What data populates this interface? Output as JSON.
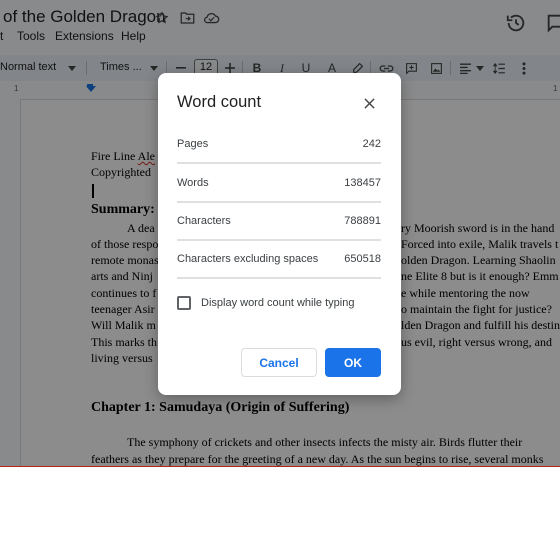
{
  "document": {
    "title": "of the Golden Dragon",
    "menu": [
      "t",
      "Tools",
      "Extensions",
      "Help"
    ]
  },
  "toolbar": {
    "style": "Normal text",
    "font": "Times ...",
    "font_size": "12"
  },
  "ruler": {
    "left_number": "1",
    "right_number": "1"
  },
  "body": {
    "line1_prefix": "Fire Line ",
    "line1_misspelled": "Ale",
    "line2": "Copyrighted",
    "summary_heading": "Summary:",
    "left_lines": [
      "A dea",
      "of those respo",
      "remote monas",
      "arts and Ninj",
      "continues to f",
      "teenager Asir",
      "Will Malik m",
      "This marks th",
      "living versus"
    ],
    "right_lines": [
      "ry Moorish sword is in the hand",
      "Forced into exile, Malik travels t",
      "olden Dragon. Learning Shaolin",
      "ne Elite 8 but is it enough?  Emm",
      "e while mentoring the now",
      "o maintain the fight for justice?",
      "lden Dragon and fulfill his destin",
      "us evil, right versus wrong, and"
    ],
    "chapter_heading": "Chapter 1: Samudaya (Origin of Suffering)",
    "chapter_line1": "The symphony of crickets and other insects infects the misty air. Birds flutter their",
    "chapter_line2": "feathers as they prepare for the greeting of a new day. As the sun begins to rise, several monks"
  },
  "dialog": {
    "title": "Word count",
    "stats": [
      {
        "label": "Pages",
        "value": "242"
      },
      {
        "label": "Words",
        "value": "138457"
      },
      {
        "label": "Characters",
        "value": "788891"
      },
      {
        "label": "Characters excluding spaces",
        "value": "650518"
      }
    ],
    "checkbox_label": "Display word count while typing",
    "checkbox_checked": false,
    "cancel_label": "Cancel",
    "ok_label": "OK"
  },
  "colors": {
    "accent": "#1a73e8",
    "scrim": "rgba(0,0,0,0.45)"
  },
  "icons": [
    "star-icon",
    "move-folder-icon",
    "cloud-status-icon",
    "history-icon",
    "comments-icon",
    "close-icon",
    "bold-icon",
    "italic-icon",
    "underline-icon",
    "text-color-icon",
    "highlight-icon",
    "link-icon",
    "comment-add-icon",
    "image-icon",
    "align-icon",
    "line-spacing-icon",
    "more-icon"
  ]
}
